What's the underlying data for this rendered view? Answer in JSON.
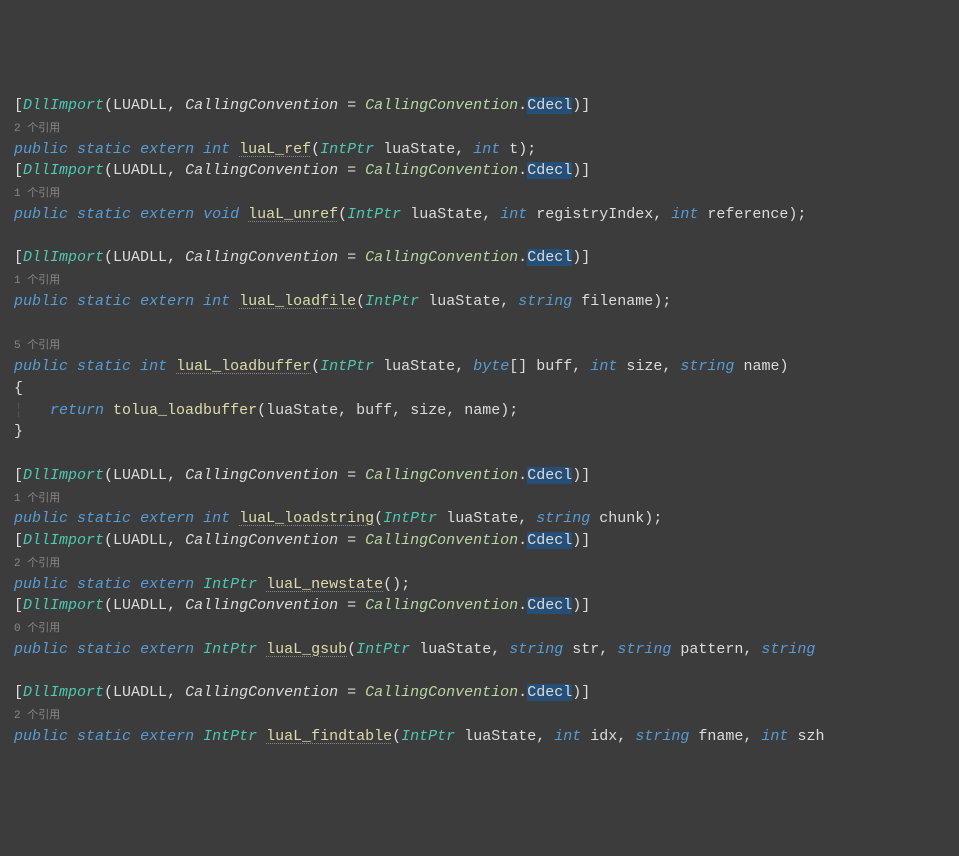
{
  "refs": {
    "r2": "2 个引用",
    "r1": "1 个引用",
    "r5": "5 个引用",
    "r0": "0 个引用"
  },
  "tokens": {
    "bracket_open": "[",
    "bracket_close": "]",
    "paren_open": "(",
    "paren_close": ")",
    "brace_open": "{",
    "brace_close": "}",
    "semicolon": ";",
    "comma": ",",
    "dot": ".",
    "eq": " = ",
    "sq_open": "[",
    "sq_close": "]"
  },
  "attr": {
    "DllImport": "DllImport",
    "LUADLL": "LUADLL",
    "CallingConvention": "CallingConvention",
    "CallingConventionEnum": "CallingConvention",
    "Cdecl": "Cdecl"
  },
  "kw": {
    "public": "public",
    "static": "static",
    "extern": "extern",
    "int": "int",
    "void": "void",
    "string": "string",
    "byte": "byte",
    "return": "return"
  },
  "types": {
    "IntPtr": "IntPtr"
  },
  "methods": {
    "luaL_ref": "luaL_ref",
    "luaL_unref": "luaL_unref",
    "luaL_loadfile": "luaL_loadfile",
    "luaL_loadbuffer": "luaL_loadbuffer",
    "tolua_loadbuffer": "tolua_loadbuffer",
    "luaL_loadstring": "luaL_loadstring",
    "luaL_newstate": "luaL_newstate",
    "luaL_gsub": "luaL_gsub",
    "luaL_findtable": "luaL_findtable"
  },
  "params": {
    "luaState": "luaState",
    "t": "t",
    "registryIndex": "registryIndex",
    "reference": "reference",
    "filename": "filename",
    "buff": "buff",
    "size": "size",
    "name": "name",
    "chunk": "chunk",
    "str": "str",
    "pattern": "pattern",
    "idx": "idx",
    "fname": "fname",
    "szh": "szh"
  },
  "indent": "¦   "
}
